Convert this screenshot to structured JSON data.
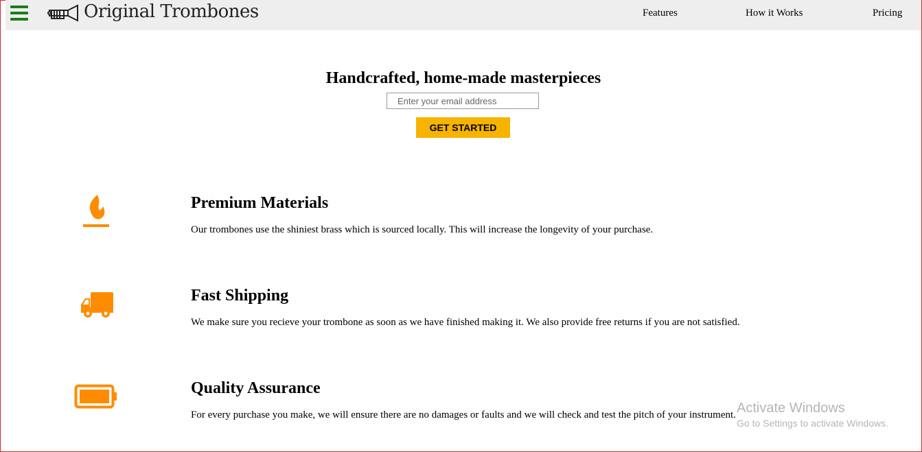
{
  "header": {
    "menu_icon": "hamburger-icon",
    "logo_icon": "trombone-icon",
    "logo_text": "Original Trombones",
    "nav": [
      {
        "label": "Features"
      },
      {
        "label": "How it Works"
      },
      {
        "label": "Pricing"
      }
    ]
  },
  "hero": {
    "title": "Handcrafted, home-made masterpieces",
    "email_placeholder": "Enter your email address",
    "email_value": "",
    "cta_label": "GET STARTED"
  },
  "features": [
    {
      "icon": "fire-icon",
      "title": "Premium Materials",
      "description": "Our trombones use the shiniest brass which is sourced locally. This will increase the longevity of your purchase."
    },
    {
      "icon": "truck-icon",
      "title": "Fast Shipping",
      "description": "We make sure you recieve your trombone as soon as we have finished making it. We also provide free returns if you are not satisfied."
    },
    {
      "icon": "battery-full-icon",
      "title": "Quality Assurance",
      "description": "For every purchase you make, we will ensure there are no damages or faults and we will check and test the pitch of your instrument."
    }
  ],
  "watermark": {
    "title": "Activate Windows",
    "subtitle": "Go to Settings to activate Windows."
  },
  "colors": {
    "accent": "#f6b300",
    "icon": "#ff8c00",
    "menu": "#1a7d1a",
    "header_bg": "#eeeeee"
  }
}
